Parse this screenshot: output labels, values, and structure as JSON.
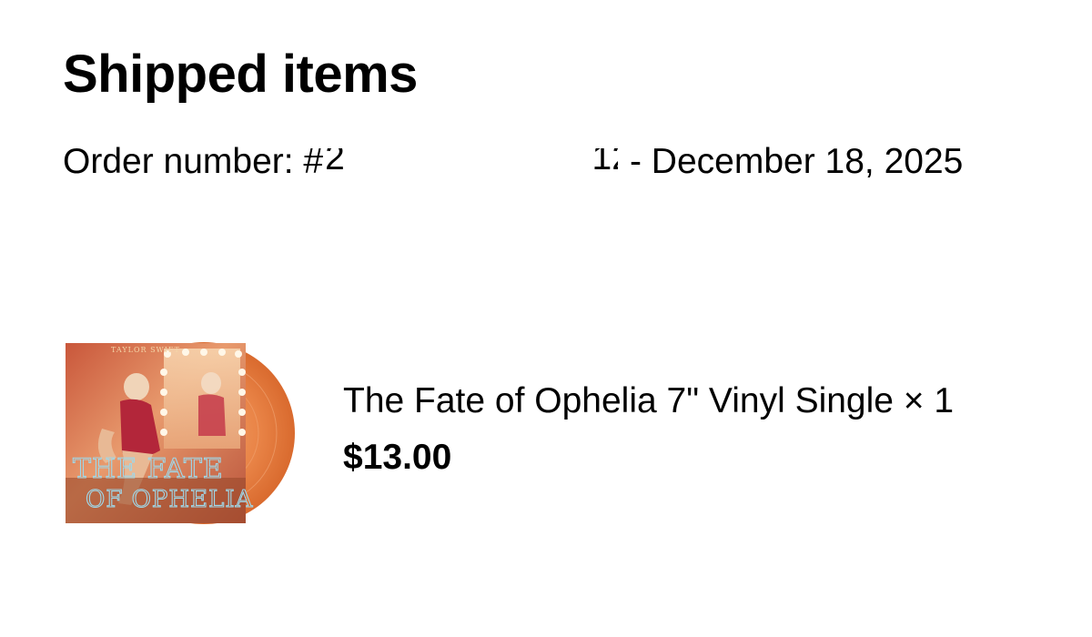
{
  "header": {
    "title": "Shipped items"
  },
  "order": {
    "label": "Order number: #",
    "number_visible_prefix": "2b",
    "number_visible_suffix": "12",
    "separator": " - ",
    "date": "December 18, 2025"
  },
  "items": [
    {
      "name": "The Fate of Ophelia 7\" Vinyl Single × 1",
      "price": "$13.00",
      "image": {
        "icon": "vinyl-record-album-art",
        "cover_title_line1": "THE FATE",
        "cover_title_line2": "OF OPHELIA",
        "record_color": "#E8824A"
      }
    }
  ],
  "colors": {
    "background": "#FFFFFF",
    "text": "#000000"
  }
}
